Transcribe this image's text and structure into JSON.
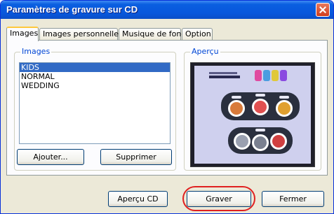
{
  "window": {
    "title": "Paramètres de gravure sur CD"
  },
  "tabs": [
    {
      "label": "Images"
    },
    {
      "label": "Images personnelles"
    },
    {
      "label": "Musique de fond"
    },
    {
      "label": "Option"
    }
  ],
  "images_group": {
    "legend": "Images",
    "items": [
      "KIDS",
      "NORMAL",
      "WEDDING"
    ],
    "add_label": "Ajouter...",
    "delete_label": "Supprimer"
  },
  "preview_group": {
    "legend": "Aperçu"
  },
  "footer": {
    "preview_label": "Aperçu CD",
    "burn_label": "Graver",
    "close_label": "Fermer"
  },
  "colors": {
    "title_bar": "#0857dc",
    "selection": "#316ac5",
    "highlight_ring": "#e02020"
  }
}
